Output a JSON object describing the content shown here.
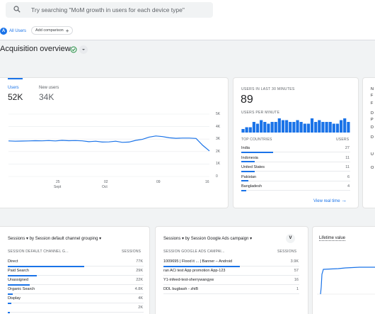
{
  "search": {
    "placeholder": "Try searching \"MoM growth in users for each device type\""
  },
  "comparison": {
    "all_users": "All Users",
    "all_users_initial": "A",
    "add_comparison": "Add comparison",
    "add_icon": "+"
  },
  "page": {
    "title": "Acquisition overview"
  },
  "users_card": {
    "tabs": [
      {
        "label": "Users",
        "value": "52K"
      },
      {
        "label": "New users",
        "value": "34K"
      }
    ],
    "y_ticks": [
      "5K",
      "4K",
      "3K",
      "2K",
      "1K",
      "0"
    ],
    "x_ticks": [
      {
        "top": "25",
        "bottom": "Sept"
      },
      {
        "top": "02",
        "bottom": "Oct"
      },
      {
        "top": "09",
        "bottom": ""
      },
      {
        "top": "16",
        "bottom": ""
      }
    ]
  },
  "chart_data": {
    "type": "line",
    "ylim": [
      0,
      5000
    ],
    "series": [
      {
        "values": [
          2850,
          2830,
          2840,
          2850,
          2870,
          2860,
          2880,
          2850,
          2900,
          2870,
          2880,
          2860,
          2790,
          2830,
          2760,
          2770,
          2830,
          2740,
          2760,
          2900,
          2980,
          3160,
          3250,
          3200,
          3100,
          3060,
          3080,
          3080,
          3050,
          2500,
          2050
        ]
      }
    ],
    "x_ticks": [
      "25 Sept",
      "02 Oct",
      "09",
      "16"
    ]
  },
  "realtime": {
    "heading": "USERS IN LAST 30 MINUTES",
    "value": "89",
    "per_minute": "USERS PER MINUTE",
    "bars": [
      2,
      3,
      3,
      6,
      5,
      7,
      6,
      5,
      6,
      6,
      8,
      7,
      7,
      6,
      6,
      7,
      6,
      5,
      5,
      8,
      6,
      7,
      6,
      6,
      6,
      5,
      5,
      7,
      8,
      6
    ],
    "col1": "TOP COUNTRIES",
    "col2": "USERS",
    "rows": [
      {
        "name": "India",
        "value": "27",
        "pct": 0.9
      },
      {
        "name": "Indonesia",
        "value": "11",
        "pct": 0.37
      },
      {
        "name": "United States",
        "value": "11",
        "pct": 0.37
      },
      {
        "name": "Pakistan",
        "value": "6",
        "pct": 0.2
      },
      {
        "name": "Bangladesh",
        "value": "4",
        "pct": 0.13
      }
    ],
    "link": "View real time",
    "link_icon": "→"
  },
  "side_card": {
    "lines": [
      "N",
      "F",
      "F",
      "D",
      "P",
      "D",
      "D",
      "U",
      "O"
    ]
  },
  "channel_card": {
    "title": "Sessions ▾ by Session default channel grouping ▾",
    "col1": "SESSION DEFAULT CHANNEL G...",
    "col2": "SESSIONS",
    "rows": [
      {
        "name": "Direct",
        "value": "77K",
        "pct": 1.0
      },
      {
        "name": "Paid Search",
        "value": "29K",
        "pct": 0.38
      },
      {
        "name": "Unassigned",
        "value": "22K",
        "pct": 0.29
      },
      {
        "name": "Organic Search",
        "value": "4.8K",
        "pct": 0.06
      },
      {
        "name": "Display",
        "value": "4K",
        "pct": 0.05
      },
      {
        "name": "",
        "value": "2K",
        "pct": 0.03
      }
    ]
  },
  "ads_card": {
    "title": "Sessions ▾ by Session Google Ads campaign ▾",
    "badge": "V",
    "col1": "SESSION GOOGLE ADS CAMPAI...",
    "col2": "SESSIONS",
    "rows": [
      {
        "name": "1009695 | Flood it ... | Banner – Android",
        "value": "3.9K",
        "pct": 1.0
      },
      {
        "name": "ran ACi test App promotion App-123",
        "value": "57",
        "pct": 0
      },
      {
        "name": "Y1-infeed-test-sherrywangyw",
        "value": "16",
        "pct": 0
      },
      {
        "name": "DDL bugbash - zhiB",
        "value": "1",
        "pct": 0
      }
    ]
  },
  "ltv_card": {
    "title": "Lifetime value"
  }
}
